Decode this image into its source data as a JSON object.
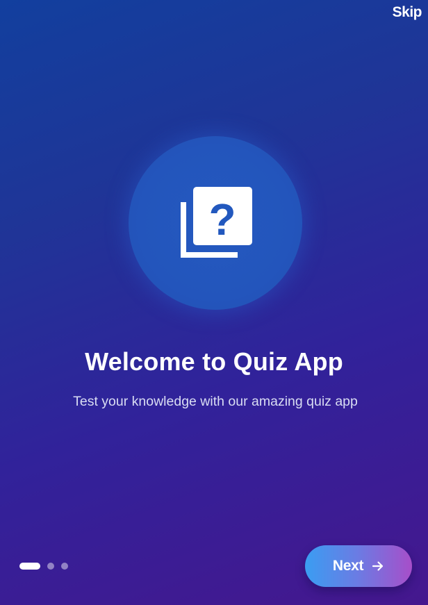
{
  "header": {
    "skip_label": "Skip"
  },
  "onboarding": {
    "icon": "question-library-icon",
    "title": "Welcome to Quiz App",
    "subtitle": "Test your knowledge with our amazing quiz app",
    "page_count": 3,
    "current_page": 1
  },
  "footer": {
    "next_label": "Next",
    "next_icon": "arrow-forward-icon"
  },
  "colors": {
    "background_start": "#123f9e",
    "background_end": "#45178e",
    "icon_circle": "#2355bc",
    "button_start": "#3a9df2",
    "button_end": "#a74ec9",
    "text": "#ffffff"
  }
}
